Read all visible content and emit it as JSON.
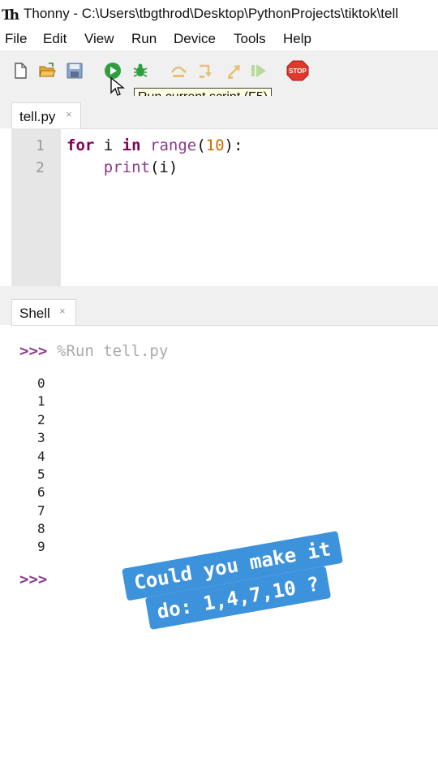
{
  "window": {
    "logo_text": "Th",
    "title": "Thonny  -  C:\\Users\\tbgthrod\\Desktop\\PythonProjects\\tiktok\\tell"
  },
  "menu": [
    "File",
    "Edit",
    "View",
    "Run",
    "Device",
    "Tools",
    "Help"
  ],
  "toolbar": {
    "icons": [
      "new-file-icon",
      "open-folder-icon",
      "save-icon",
      "run-icon",
      "debug-icon",
      "step-over-icon",
      "step-into-icon",
      "step-out-icon",
      "resume-icon",
      "stop-icon"
    ],
    "stop_label": "STOP",
    "tooltip": "Run current script (F5)",
    "colors": {
      "run": "#2e9e3e",
      "stop": "#e0392b",
      "folder": "#e8a92c",
      "disabled": "#e8c07a"
    }
  },
  "editor": {
    "tab_label": "tell.py",
    "tab_close": "×",
    "line_numbers": [
      "1",
      "2"
    ],
    "lines": [
      {
        "kw1": "for",
        "t1": " i ",
        "kw2": "in",
        "t2": " ",
        "fn": "range",
        "t3": "(",
        "num": "10",
        "t4": "):"
      },
      {
        "indent": "    ",
        "fn": "print",
        "rest": "(i)"
      }
    ]
  },
  "shell": {
    "tab_label": "Shell",
    "tab_close": "×",
    "prompt": ">>>",
    "run_command": "%Run tell.py",
    "output": [
      "0",
      "1",
      "2",
      "3",
      "4",
      "5",
      "6",
      "7",
      "8",
      "9"
    ],
    "final_prompt": ">>>"
  },
  "caption": {
    "line1": "Could you make it",
    "line2": "do: 1,4,7,10 ?",
    "color": "#3d92dc"
  }
}
